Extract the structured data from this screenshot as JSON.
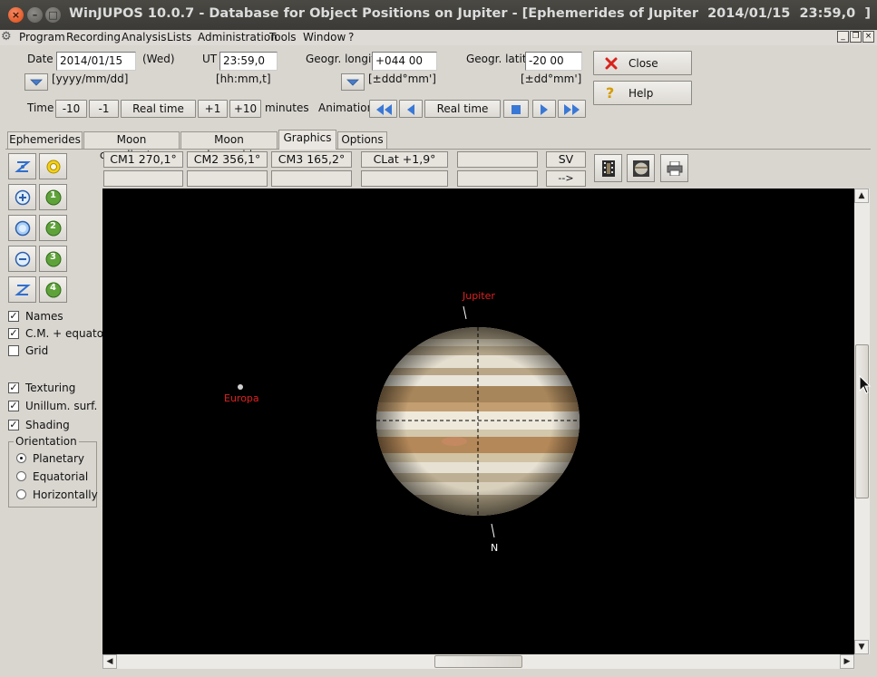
{
  "window": {
    "title": "WinJUPOS 10.0.7 - Database for Object Positions on Jupiter - [Ephemerides of Jupiter  2014/01/15  23:59,0  ]"
  },
  "menu": [
    "Program",
    "Recording",
    "Analysis",
    "Lists",
    "Administration",
    "Tools",
    "Window",
    "?"
  ],
  "form": {
    "date_label": "Date",
    "date_value": "2014/01/15",
    "weekday": "(Wed)",
    "date_format": "[yyyy/mm/dd]",
    "ut_label": "UT",
    "ut_value": "23:59,0",
    "ut_format": "[hh:mm,t]",
    "longitude_label": "Geogr. longit.",
    "longitude_value": "+044 00",
    "longitude_format": "[±ddd°mm']",
    "latitude_label": "Geogr. latit.",
    "latitude_value": "-20 00",
    "latitude_format": "[±dd°mm']",
    "close_label": "Close",
    "help_label": "Help",
    "time_label": "Time",
    "time_buttons": [
      "-10",
      "-1",
      "Real time",
      "+1",
      "+10"
    ],
    "minutes_label": "minutes",
    "animation_label": "Animation",
    "animation_realtime": "Real time"
  },
  "tabs": [
    "Ephemerides",
    "Moon coordinates",
    "Moon ephemerides",
    "Graphics",
    "Options"
  ],
  "active_tab": "Graphics",
  "options": {
    "names": "Names",
    "cm_equator": "C.M. + equator",
    "grid": "Grid",
    "texturing": "Texturing",
    "unillum": "Unillum. surf.",
    "shading": "Shading",
    "orientation_label": "Orientation",
    "planetary": "Planetary",
    "equatorial": "Equatorial",
    "horizontally": "Horizontally"
  },
  "tool_numbers": [
    "1",
    "2",
    "3",
    "4"
  ],
  "info": {
    "cm1": "CM1 270,1°",
    "cm2": "CM2 356,1°",
    "cm3": "CM3 165,2°",
    "clat": "CLat  +1,9°",
    "sv": "SV",
    "arrow": "-->"
  },
  "canvas": {
    "jupiter_label": "Jupiter",
    "europa_label": "Europa",
    "north_label": "N",
    "label_color": "#e02020"
  }
}
